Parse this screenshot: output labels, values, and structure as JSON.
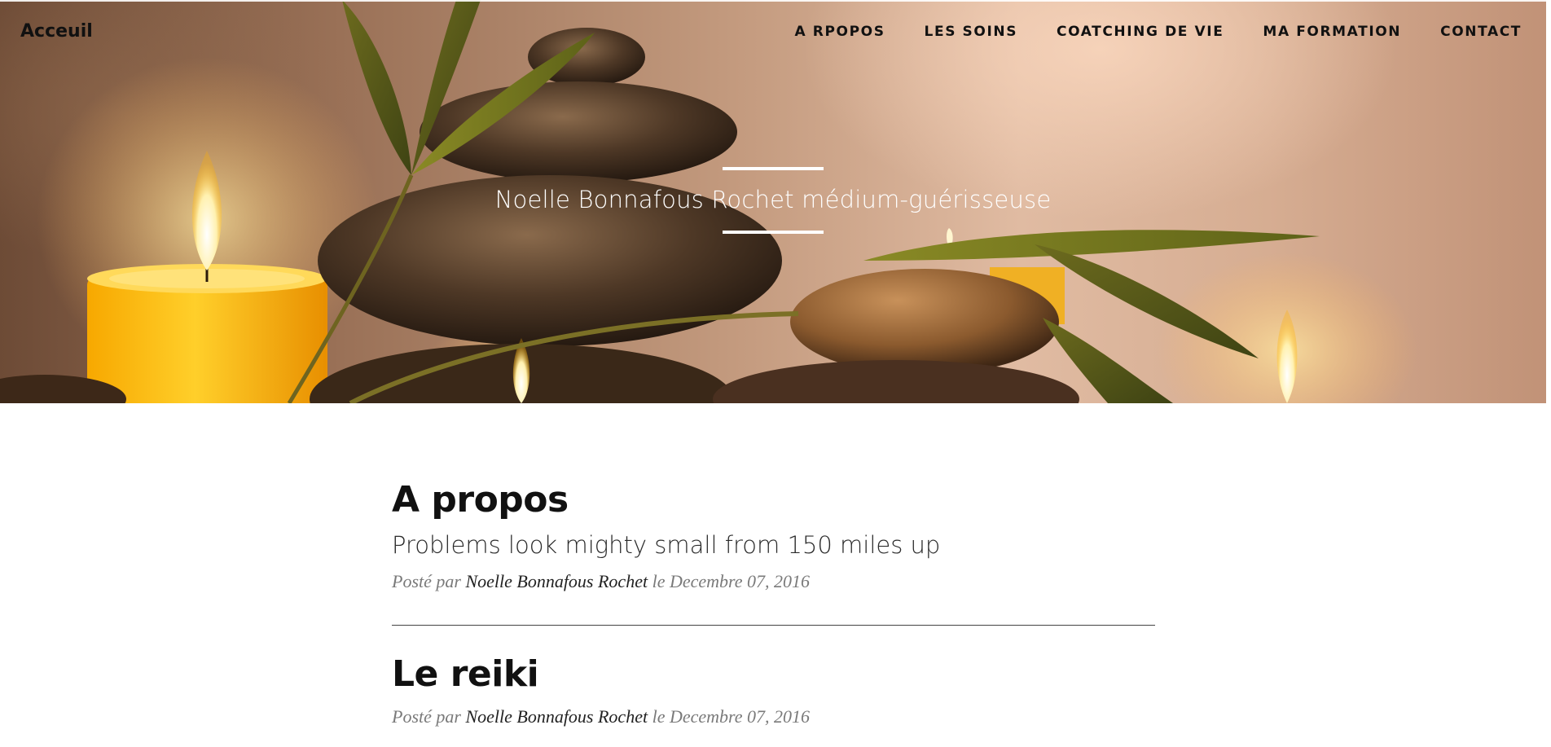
{
  "nav": {
    "brand": "Acceuil",
    "links": [
      "A RPOPOS",
      "LES SOINS",
      "COATCHING DE VIE",
      "MA FORMATION",
      "CONTACT"
    ]
  },
  "hero": {
    "subheading": "Noelle Bonnafous Rochet médium-guérisseuse",
    "image_icon": "spa-stones-candles-image"
  },
  "posts": [
    {
      "title": "A propos",
      "subtitle": "Problems look mighty small from 150 miles up",
      "meta_prefix": "Posté par",
      "author": "Noelle Bonnafous Rochet",
      "meta_date": "le Decembre 07, 2016"
    },
    {
      "title": "Le reiki",
      "meta_prefix": "Posté par",
      "author": "Noelle Bonnafous Rochet",
      "meta_date": "le Decembre 07, 2016"
    }
  ],
  "colors": {
    "nav_text": "#111111",
    "hero_text": "#ffffff",
    "post_title": "#111111",
    "meta": "#7a7a7a"
  }
}
